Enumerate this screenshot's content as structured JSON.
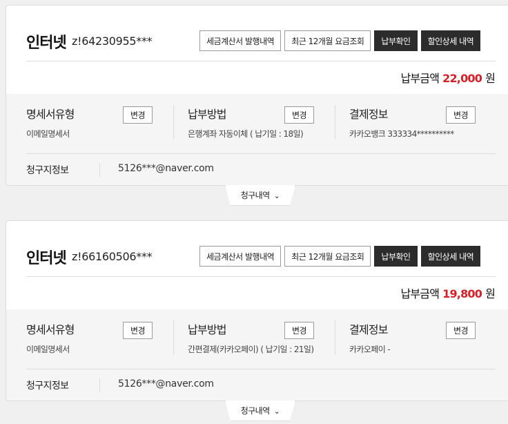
{
  "cards": [
    {
      "service": "인터넷",
      "account_no": "z!64230955***",
      "buttons": {
        "tax_invoice": "세금계산서 발행내역",
        "recent_fees": "최근 12개월 요금조회",
        "payment_check": "납부확인",
        "discount_detail": "할인상세 내역"
      },
      "amount_label": "납부금액",
      "amount_value": "22,000",
      "amount_unit": "원",
      "statement": {
        "title": "명세서유형",
        "value": "이메일명세서",
        "change": "변경"
      },
      "payment_method": {
        "title": "납부방법",
        "value": "은행계좌 자동이체 ( 납기일 : 18일)",
        "change": "변경"
      },
      "payment_info": {
        "title": "결제정보",
        "value": "카카오뱅크 333334**********",
        "change": "변경"
      },
      "billing_label": "청구지정보",
      "billing_value": "5126***@naver.com",
      "toggle_label": "청구내역"
    },
    {
      "service": "인터넷",
      "account_no": "z!66160506***",
      "buttons": {
        "tax_invoice": "세금계산서 발행내역",
        "recent_fees": "최근 12개월 요금조회",
        "payment_check": "납부확인",
        "discount_detail": "할인상세 내역"
      },
      "amount_label": "납부금액",
      "amount_value": "19,800",
      "amount_unit": "원",
      "statement": {
        "title": "명세서유형",
        "value": "이메일명세서",
        "change": "변경"
      },
      "payment_method": {
        "title": "납부방법",
        "value": "간편결제(카카오페이) ( 납기일 : 21일)",
        "change": "변경"
      },
      "payment_info": {
        "title": "결제정보",
        "value": "카카오페이 -",
        "change": "변경"
      },
      "billing_label": "청구지정보",
      "billing_value": "5126***@naver.com",
      "toggle_label": "청구내역"
    }
  ],
  "colors": {
    "amount": "#d5202a",
    "dark_button": "#2c2c2c"
  },
  "icons": {
    "toggle": "chevron-down-icon"
  }
}
